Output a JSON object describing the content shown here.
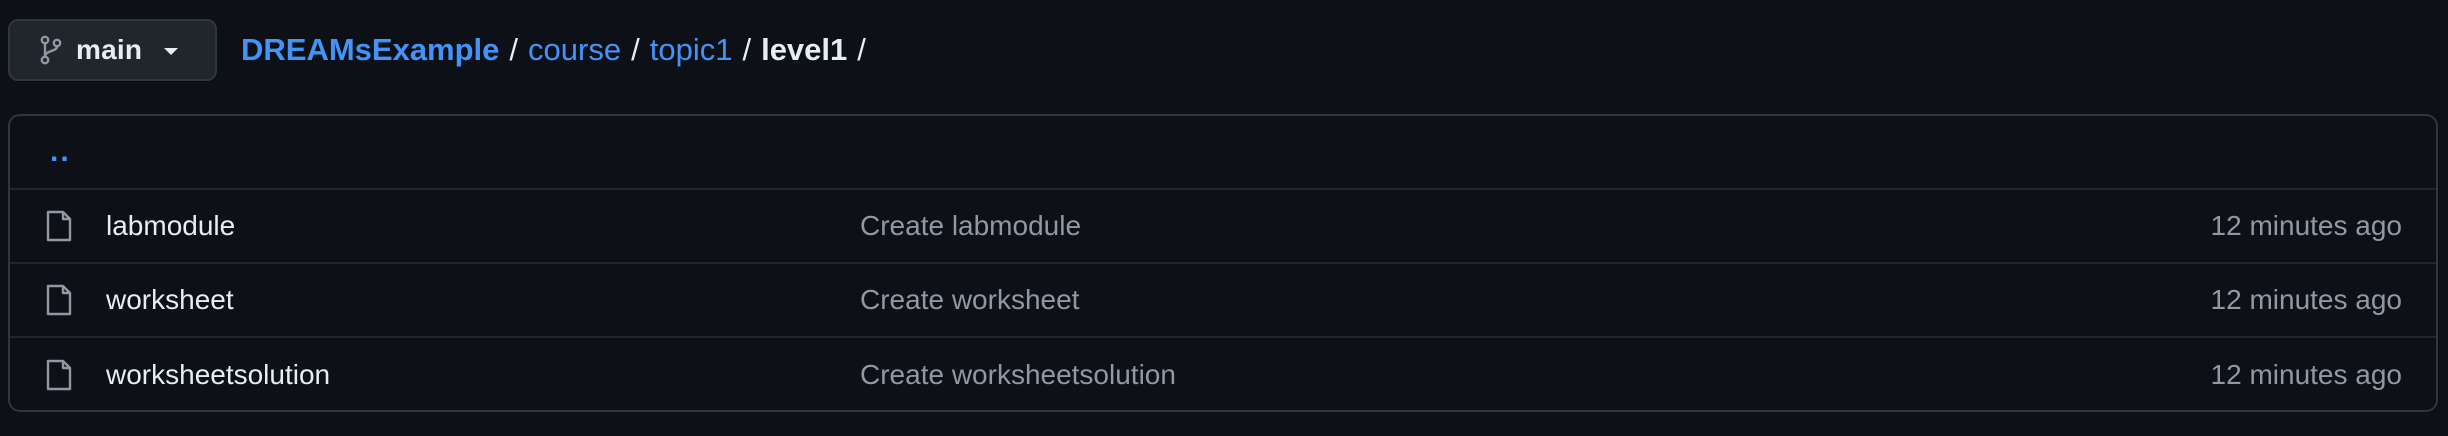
{
  "branch": {
    "icon": "git-branch-icon",
    "label": "main"
  },
  "breadcrumb": {
    "repo": "DREAMsExample",
    "segments": [
      "course",
      "topic1"
    ],
    "current": "level1",
    "separator": "/"
  },
  "parent_dir": "..",
  "files": [
    {
      "icon": "file-icon",
      "name": "labmodule",
      "commit": "Create labmodule",
      "time": "12 minutes ago"
    },
    {
      "icon": "file-icon",
      "name": "worksheet",
      "commit": "Create worksheet",
      "time": "12 minutes ago"
    },
    {
      "icon": "file-icon",
      "name": "worksheetsolution",
      "commit": "Create worksheetsolution",
      "time": "12 minutes ago"
    }
  ],
  "colors": {
    "background": "#0d1117",
    "link": "#4493f8",
    "text": "#e6edf3",
    "muted": "#9198a1",
    "border": "#30363d"
  }
}
